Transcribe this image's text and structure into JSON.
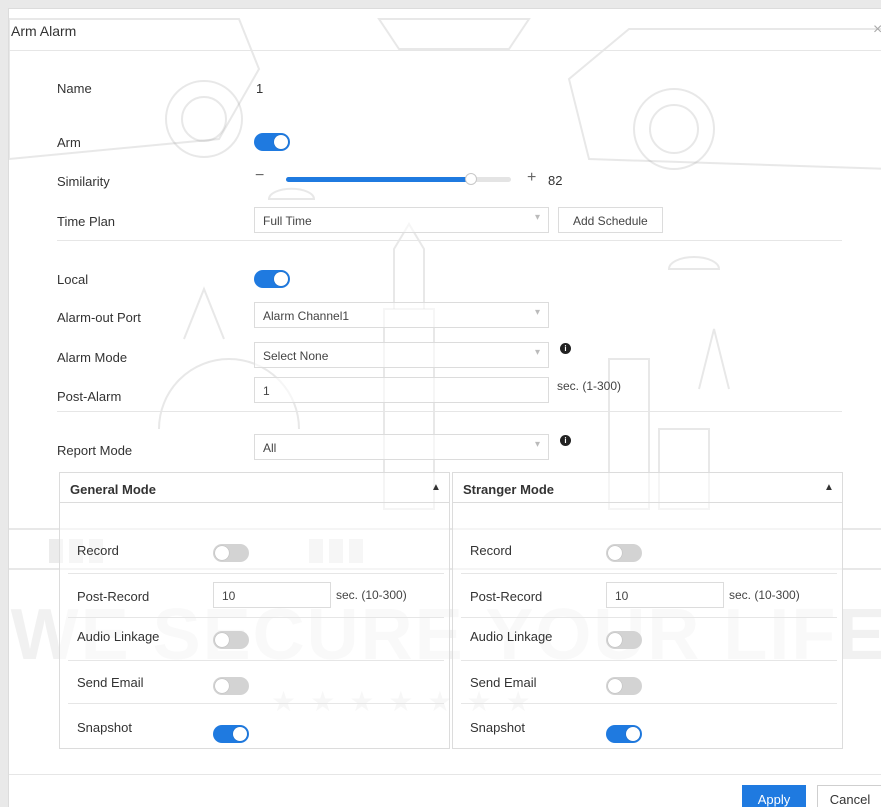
{
  "dialog": {
    "title": "Arm Alarm",
    "close_icon": "×"
  },
  "name": {
    "label": "Name",
    "value": "1"
  },
  "arm": {
    "label": "Arm",
    "enabled": true
  },
  "similarity": {
    "label": "Similarity",
    "minus": "−",
    "plus": "+",
    "value": "82",
    "percent": 82
  },
  "time_plan": {
    "label": "Time Plan",
    "value": "Full Time",
    "add_schedule": "Add Schedule"
  },
  "local": {
    "label": "Local",
    "enabled": true
  },
  "alarm_out_port": {
    "label": "Alarm-out Port",
    "value": "Alarm Channel1"
  },
  "alarm_mode": {
    "label": "Alarm Mode",
    "value": "Select None"
  },
  "post_alarm": {
    "label": "Post-Alarm",
    "value": "1",
    "hint": "sec. (1-300)"
  },
  "report_mode": {
    "label": "Report Mode",
    "value": "All"
  },
  "general_mode": {
    "title": "General Mode",
    "record": {
      "label": "Record",
      "enabled": false
    },
    "post_record": {
      "label": "Post-Record",
      "value": "10",
      "hint": "sec. (10-300)"
    },
    "audio_linkage": {
      "label": "Audio Linkage",
      "enabled": false
    },
    "send_email": {
      "label": "Send Email",
      "enabled": false
    },
    "snapshot": {
      "label": "Snapshot",
      "enabled": true
    }
  },
  "stranger_mode": {
    "title": "Stranger Mode",
    "record": {
      "label": "Record",
      "enabled": false
    },
    "post_record": {
      "label": "Post-Record",
      "value": "10",
      "hint": "sec. (10-300)"
    },
    "audio_linkage": {
      "label": "Audio Linkage",
      "enabled": false
    },
    "send_email": {
      "label": "Send Email",
      "enabled": false
    },
    "snapshot": {
      "label": "Snapshot",
      "enabled": true
    }
  },
  "footer": {
    "apply": "Apply",
    "cancel": "Cancel"
  },
  "watermark": {
    "text": "WE SECURE YOUR LIFE",
    "stars": "★★★★★★★"
  },
  "colors": {
    "accent": "#1f7ae0",
    "toggle_off": "#d3d3d3"
  },
  "icons": {
    "info": "info-icon",
    "chevron_up": "chevron-up-icon",
    "chevron_down": "chevron-down-icon",
    "close": "close-icon"
  }
}
